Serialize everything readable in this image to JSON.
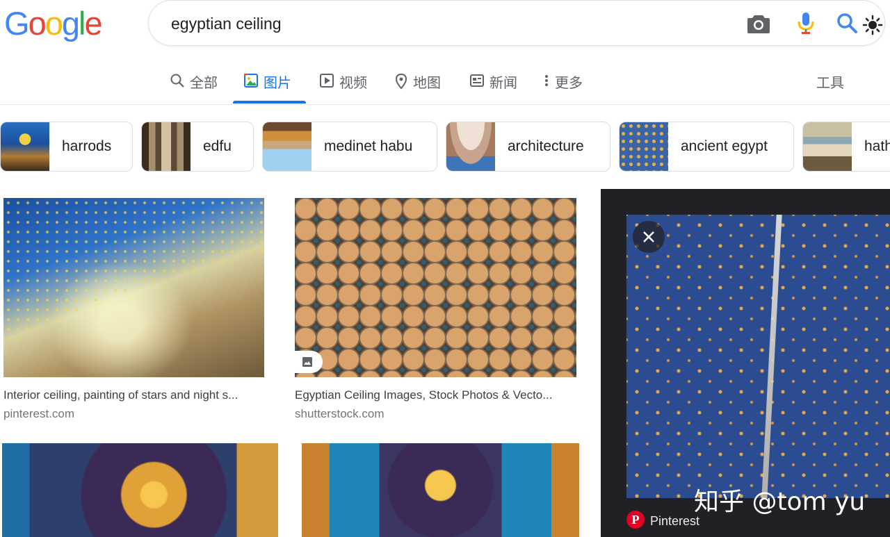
{
  "logo": {
    "letters": [
      "G",
      "o",
      "o",
      "g",
      "l",
      "e"
    ]
  },
  "search": {
    "query": "egyptian ceiling"
  },
  "tabs": [
    {
      "label": "全部",
      "icon": "search-icon"
    },
    {
      "label": "图片",
      "icon": "image-icon"
    },
    {
      "label": "视频",
      "icon": "play-icon"
    },
    {
      "label": "地图",
      "icon": "map-pin-icon"
    },
    {
      "label": "新闻",
      "icon": "news-icon"
    },
    {
      "label": "更多",
      "icon": "more-vert-icon"
    }
  ],
  "tools_label": "工具",
  "chips": [
    {
      "label": "harrods"
    },
    {
      "label": "edfu"
    },
    {
      "label": "medinet habu"
    },
    {
      "label": "architecture"
    },
    {
      "label": "ancient egypt"
    },
    {
      "label": "hath"
    }
  ],
  "results": [
    {
      "title": "Interior ceiling, painting of stars and night s...",
      "source": "pinterest.com"
    },
    {
      "title": "Egyptian Ceiling Images, Stock Photos & Vecto...",
      "source": "shutterstock.com"
    }
  ],
  "preview": {
    "watermark": "知乎 @tom yu",
    "source_name": "Pinterest"
  },
  "colors": {
    "accent": "#1a73e8",
    "logo_blue": "#4285f4",
    "logo_red": "#ea4335",
    "logo_yellow": "#fbbc05",
    "logo_green": "#34a853",
    "pinterest_red": "#e60023"
  }
}
